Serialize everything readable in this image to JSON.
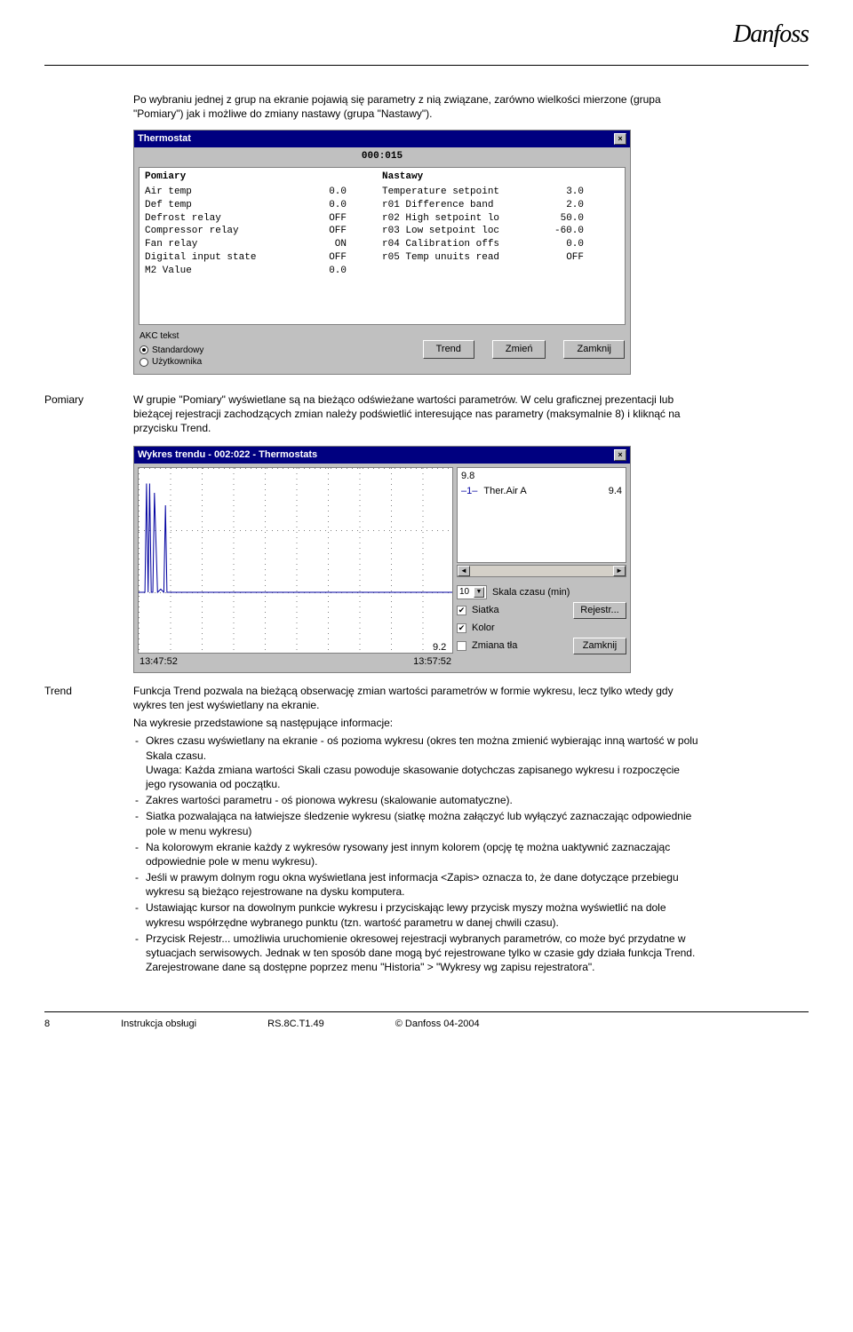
{
  "header": {
    "logo_text": "Danfoss"
  },
  "intro": "Po wybraniu jednej z grup na ekranie pojawią się parametry z nią związane, zarówno wielkości mierzone (grupa \"Pomiary\") jak i możliwe do zmiany nastawy (grupa \"Nastawy\").",
  "thermo_win": {
    "title": "Thermostat",
    "id": "000:015",
    "left_header": "Pomiary",
    "right_header": "Nastawy",
    "left_rows": [
      {
        "n": "Air temp",
        "v": "0.0"
      },
      {
        "n": "Def temp",
        "v": "0.0"
      },
      {
        "n": "Defrost relay",
        "v": "OFF"
      },
      {
        "n": "Compressor relay",
        "v": "OFF"
      },
      {
        "n": "Fan relay",
        "v": "ON"
      },
      {
        "n": "Digital input state",
        "v": "OFF"
      },
      {
        "n": "M2 Value",
        "v": "0.0"
      }
    ],
    "right_rows": [
      {
        "n": "Temperature setpoint",
        "v": "3.0"
      },
      {
        "n": "r01 Difference band",
        "v": "2.0"
      },
      {
        "n": "r02 High setpoint lo",
        "v": "50.0"
      },
      {
        "n": "r03 Low setpoint loc",
        "v": "-60.0"
      },
      {
        "n": "r04 Calibration offs",
        "v": "0.0"
      },
      {
        "n": "r05 Temp unuits read",
        "v": "OFF"
      }
    ],
    "radio_label": "AKC tekst",
    "radio_opt1": "Standardowy",
    "radio_opt2": "Użytkownika",
    "btn_trend": "Trend",
    "btn_change": "Zmień",
    "btn_close": "Zamknij"
  },
  "pomiary_label": "Pomiary",
  "pomiary_text": "W grupie \"Pomiary\" wyświetlane są na bieżąco odświeżane wartości parametrów. W celu graficznej prezentacji lub bieżącej rejestracji zachodzących zmian należy podświetlić interesujące nas parametry (maksymalnie 8) i kliknąć na przycisku Trend.",
  "trend_win": {
    "title": "Wykres trendu - 002:022           - Thermostats",
    "y_top": "9.8",
    "y_bot": "9.2",
    "x_left": "13:47:52",
    "x_right": "13:57:52",
    "legend_idx": "–1–",
    "legend_name": "Ther.Air A",
    "legend_val": "9.4",
    "scale_val": "10",
    "scale_label": "Skala czasu (min)",
    "chk1": "Siatka",
    "chk2": "Kolor",
    "chk3": "Zmiana tła",
    "btn_rec": "Rejestr...",
    "btn_close": "Zamknij"
  },
  "chart_data": {
    "type": "line",
    "title": "Wykres trendu - 002:022 - Thermostats",
    "xlabel": "time",
    "ylabel": "Ther.Air A",
    "ylim": [
      9.2,
      9.8
    ],
    "x_ticks": [
      "13:47:52",
      "13:57:52"
    ],
    "series": [
      {
        "name": "Ther.Air A",
        "color": "#0000a0",
        "current": 9.4,
        "x_frac": [
          0.0,
          0.02,
          0.025,
          0.03,
          0.035,
          0.04,
          0.045,
          0.05,
          0.06,
          0.07,
          0.08,
          0.085,
          0.09,
          0.1,
          0.12,
          1.0
        ],
        "values": [
          9.4,
          9.4,
          9.75,
          9.4,
          9.75,
          9.4,
          9.4,
          9.72,
          9.4,
          9.41,
          9.4,
          9.68,
          9.4,
          9.4,
          9.4,
          9.4
        ]
      }
    ]
  },
  "trend_label": "Trend",
  "trend_intro": "Funkcja Trend pozwala na bieżącą obserwację zmian wartości parametrów w formie wykresu, lecz tylko wtedy gdy wykres ten jest wyświetlany na ekranie.",
  "trend_list_intro": "Na wykresie przedstawione są następujące informacje:",
  "trend_items": [
    "Okres czasu wyświetlany na ekranie - oś pozioma wykresu (okres ten można zmienić wybierając inną wartość w polu Skala czasu.\nUwaga: Każda zmiana wartości Skali czasu powoduje skasowanie dotychczas zapisanego wykresu i rozpoczęcie jego rysowania od początku.",
    "Zakres wartości parametru - oś pionowa wykresu (skalowanie automatyczne).",
    "Siatka pozwalająca na łatwiejsze śledzenie wykresu (siatkę można załączyć lub wyłączyć zaznaczając odpowiednie pole w menu wykresu)",
    "Na kolorowym ekranie każdy z wykresów rysowany jest innym kolorem (opcję tę można uaktywnić zaznaczając odpowiednie pole w menu wykresu).",
    "Jeśli w prawym dolnym rogu okna wyświetlana jest informacja <Zapis> oznacza to, że dane dotyczące przebiegu wykresu są bieżąco rejestrowane na dysku komputera.",
    "Ustawiając kursor na dowolnym punkcie wykresu i przyciskając lewy przycisk myszy można wyświetlić na dole wykresu współrzędne wybranego punktu (tzn. wartość parametru w danej chwili czasu).",
    "Przycisk Rejestr... umożliwia uruchomienie okresowej rejestracji wybranych parametrów, co może być przydatne w sytuacjach serwisowych. Jednak w ten sposób dane mogą być rejestrowane tylko w czasie gdy działa funkcja Trend. Zarejestrowane dane są dostępne poprzez menu \"Historia\" > \"Wykresy wg zapisu rejestratora\"."
  ],
  "footer": {
    "page": "8",
    "c1": "Instrukcja obsługi",
    "c2": "RS.8C.T1.49",
    "c3": "© Danfoss  04-2004"
  }
}
